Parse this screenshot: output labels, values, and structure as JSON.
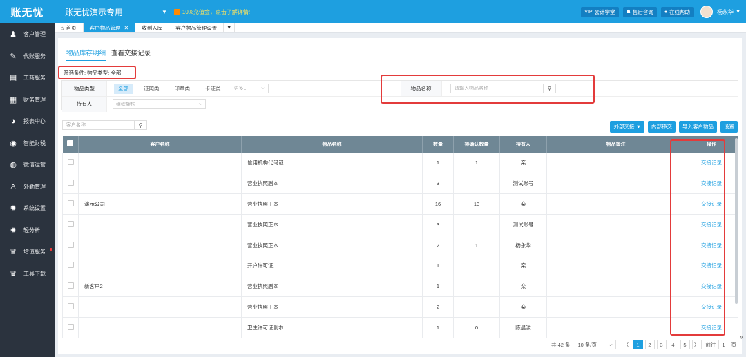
{
  "app": {
    "logo": "账无忧",
    "title": "账无忧演示专用",
    "promo": "10%充值金，点击了解详情!"
  },
  "top_buttons": [
    {
      "icon": "VIP",
      "label": "会计学堂"
    },
    {
      "icon": "☗",
      "label": "售后咨询"
    },
    {
      "icon": "●",
      "label": "在线帮助"
    }
  ],
  "user": {
    "name": "杨永华"
  },
  "sidebar": {
    "items": [
      {
        "icon": "♟",
        "label": "客户管理"
      },
      {
        "icon": "✎",
        "label": "代账服务"
      },
      {
        "icon": "▤",
        "label": "工商服务"
      },
      {
        "icon": "▦",
        "label": "财务管理"
      },
      {
        "icon": "◕",
        "label": "报表中心"
      },
      {
        "icon": "◉",
        "label": "智能财税"
      },
      {
        "icon": "◍",
        "label": "微信运营"
      },
      {
        "icon": "♙",
        "label": "外勤管理"
      },
      {
        "icon": "✹",
        "label": "系统设置"
      },
      {
        "icon": "✹",
        "label": "轻分析"
      },
      {
        "icon": "♛",
        "label": "增值服务"
      },
      {
        "icon": "♛",
        "label": "工具下载"
      }
    ]
  },
  "tabs": [
    {
      "label": "首页",
      "icon": "⌂"
    },
    {
      "label": "客户物品管理",
      "close": "✕"
    },
    {
      "label": "收到入库"
    },
    {
      "label": "客户物品管理设置"
    }
  ],
  "subtabs": [
    "物品库存明细",
    "查看交接记录"
  ],
  "filter_summary": "筛选条件: 物品类型: 全部",
  "filters": {
    "type_label": "物品类型",
    "type_options": [
      "全部",
      "证照类",
      "印章类",
      "卡证类"
    ],
    "more_placeholder": "更多...",
    "holder_label": "持有人",
    "holder_placeholder": "组织架构",
    "name_label": "物品名称",
    "name_placeholder": "请输入物品名称"
  },
  "customer_search_placeholder": "客户名称",
  "actions": [
    "外部交接 ▼",
    "内部移交",
    "导入客户物品",
    "设置"
  ],
  "table": {
    "headers": [
      "客户名称",
      "物品名称",
      "数量",
      "待确认数量",
      "持有人",
      "物品备注",
      "操作"
    ],
    "link_label": "交接记录",
    "rows": [
      {
        "customer": "",
        "item": "信用机构代码证",
        "qty": "1",
        "pending": "1",
        "holder": "栾"
      },
      {
        "customer": "",
        "item": "营业执照副本",
        "qty": "3",
        "pending": "",
        "holder": "测试账号"
      },
      {
        "customer": "演示公司",
        "item": "营业执照正本",
        "qty": "16",
        "pending": "13",
        "holder": "栾"
      },
      {
        "customer": "",
        "item": "营业执照正本",
        "qty": "3",
        "pending": "",
        "holder": "测试账号"
      },
      {
        "customer": "",
        "item": "营业执照正本",
        "qty": "2",
        "pending": "1",
        "holder": "杨永华"
      },
      {
        "customer": "",
        "item": "开户许可证",
        "qty": "1",
        "pending": "",
        "holder": "栾"
      },
      {
        "customer": "新客户2",
        "item": "营业执照副本",
        "qty": "1",
        "pending": "",
        "holder": "栾"
      },
      {
        "customer": "",
        "item": "营业执照正本",
        "qty": "2",
        "pending": "",
        "holder": "栾"
      },
      {
        "customer": "",
        "item": "卫生许可证副本",
        "qty": "1",
        "pending": "0",
        "holder": "陈晨波"
      }
    ]
  },
  "pager": {
    "total": "共 42 条",
    "page_size": "10 条/页",
    "prev": "〈",
    "pages": [
      "1",
      "2",
      "3",
      "4",
      "5"
    ],
    "next": "〉",
    "goto_label": "前往",
    "goto_value": "1",
    "page_suffix": "页"
  },
  "colors": {
    "primary": "#1e9fe0",
    "sidebar": "#2b333e",
    "header_row": "#6f8795",
    "highlight": "#e33b3b"
  }
}
